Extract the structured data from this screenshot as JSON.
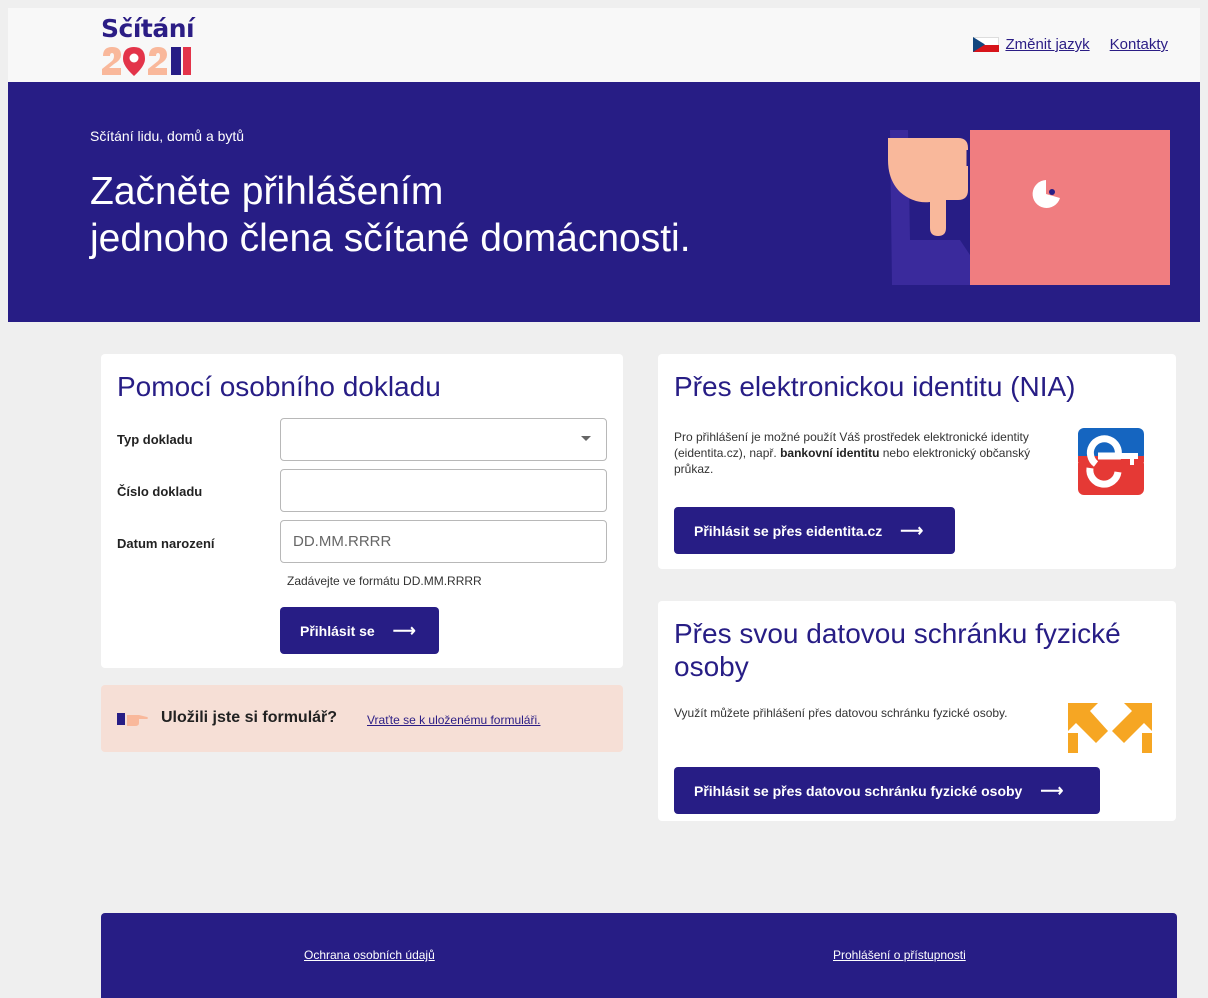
{
  "header": {
    "logo_text": "Sčítání",
    "logo_year": "2021",
    "change_language": "Změnit jazyk",
    "contacts": "Kontakty"
  },
  "hero": {
    "subtitle": "Sčítání lidu, domů a bytů",
    "title_line1": "Začněte přihlášením",
    "title_line2": "jednoho člena sčítané domácnosti."
  },
  "doc_card": {
    "title": "Pomocí osobního dokladu",
    "type_label": "Typ dokladu",
    "type_value": "",
    "number_label": "Číslo dokladu",
    "number_value": "",
    "birth_label": "Datum narození",
    "birth_placeholder": "DD.MM.RRRR",
    "birth_hint": "Zadávejte ve formátu DD.MM.RRRR",
    "submit_label": "Přihlásit se",
    "arrow": "⟶"
  },
  "saved": {
    "question": "Uložili jste si formulář?",
    "link": "Vraťte se k uloženému formuláři."
  },
  "nia_card": {
    "title": "Přes elektronickou identitu (NIA)",
    "text_part1": "Pro přihlášení je možné použít Váš prostředek elektronické identity (eidentita.cz), např. ",
    "text_bold": "bankovní identitu",
    "text_part2": " nebo elektronický občanský průkaz.",
    "button_label": "Přihlásit se přes eidentita.cz",
    "arrow": "⟶"
  },
  "ds_card": {
    "title": "Přes svou datovou schránku fyzické osoby",
    "text": "Využít můžete přihlášení přes datovou schránku fyzické osoby.",
    "button_label": "Přihlásit se přes datovou schránku fyzické osoby",
    "arrow": "⟶"
  },
  "footer": {
    "privacy": "Ochrana osobních údajů",
    "accessibility": "Prohlášení o přístupnosti"
  },
  "colors": {
    "primary": "#271d85",
    "pink": "#f47d80",
    "skin": "#f9b89b",
    "saved_bg": "#f6dfd6",
    "orange": "#f6a623"
  }
}
